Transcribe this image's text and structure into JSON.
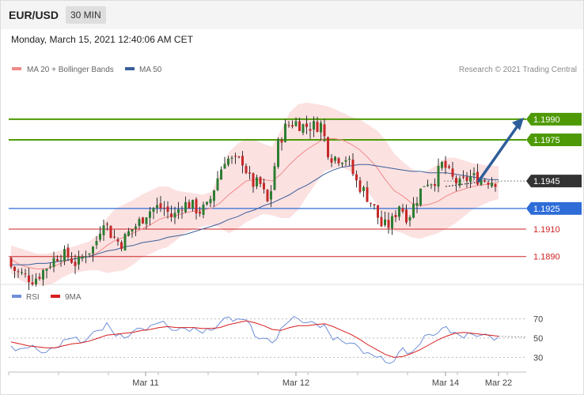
{
  "header": {
    "symbol": "EUR/USD",
    "timeframe": "30 MIN"
  },
  "datetime": "Monday, March 15, 2021 12:40:06 AM CET",
  "legend": {
    "bollinger": {
      "label": "MA 20 + Bollinger Bands",
      "color": "#f08a8a"
    },
    "ma50": {
      "label": "MA 50",
      "color": "#3a5f9a"
    }
  },
  "copyright": "Research © 2021 Trading Central",
  "rsi_legend": {
    "rsi": {
      "label": "RSI",
      "color": "#6f8fd8"
    },
    "ma9": {
      "label": "9MA",
      "color": "#d81e1e"
    }
  },
  "chart_data": [
    {
      "type": "candlestick",
      "y_range": [
        1.1872,
        1.2021
      ],
      "current_price": 1.1945,
      "levels": [
        {
          "value": 1.199,
          "label": "1.1990",
          "kind": "resistance",
          "color": "#4e9a06"
        },
        {
          "value": 1.1975,
          "label": "1.1975",
          "kind": "resistance",
          "color": "#4e9a06"
        },
        {
          "value": 1.1945,
          "label": "1.1945",
          "kind": "current",
          "color": "#333333"
        },
        {
          "value": 1.1925,
          "label": "1.1925",
          "kind": "pivot",
          "color": "#2e6dd8"
        },
        {
          "value": 1.191,
          "label": "1.1910",
          "kind": "support",
          "color": "#cc2222"
        },
        {
          "value": 1.189,
          "label": "1.1890",
          "kind": "support",
          "color": "#cc2222"
        }
      ],
      "target_arrow": {
        "from": 1.1945,
        "to": 1.199
      },
      "x_ticks": [
        "Mar 11",
        "Mar 12",
        "Mar 14",
        "Mar 22"
      ],
      "anchors": [
        1.1885,
        1.1879,
        1.1876,
        1.1873,
        1.1879,
        1.1886,
        1.1892,
        1.189,
        1.1884,
        1.1893,
        1.1897,
        1.1918,
        1.1905,
        1.1899,
        1.1908,
        1.1914,
        1.1922,
        1.1926,
        1.1925,
        1.1918,
        1.1928,
        1.1928,
        1.1923,
        1.1926,
        1.1945,
        1.1962,
        1.1959,
        1.196,
        1.1943,
        1.1943,
        1.1927,
        1.197,
        1.1985,
        1.1988,
        1.1985,
        1.1985,
        1.1986,
        1.1963,
        1.1962,
        1.1962,
        1.1945,
        1.1937,
        1.1927,
        1.1912,
        1.1913,
        1.1928,
        1.1918,
        1.1932,
        1.1945,
        1.1945,
        1.1958,
        1.1947,
        1.1942,
        1.1948,
        1.1947,
        1.1946,
        1.1945
      ],
      "ma20": [
        1.1888,
        1.1884,
        1.1882,
        1.1881,
        1.1881,
        1.1883,
        1.1886,
        1.1888,
        1.1889,
        1.189,
        1.1893,
        1.1898,
        1.1902,
        1.1904,
        1.1907,
        1.191,
        1.1913,
        1.1917,
        1.1919,
        1.192,
        1.1922,
        1.1923,
        1.1924,
        1.1925,
        1.1929,
        1.1935,
        1.194,
        1.1945,
        1.1946,
        1.1946,
        1.1945,
        1.195,
        1.1957,
        1.1963,
        1.1968,
        1.1972,
        1.1976,
        1.1976,
        1.1975,
        1.1972,
        1.1968,
        1.1962,
        1.1955,
        1.1946,
        1.1938,
        1.1934,
        1.1929,
        1.1927,
        1.1928,
        1.193,
        1.1934,
        1.1937,
        1.1939,
        1.1941,
        1.1942,
        1.1943,
        1.1944
      ],
      "bb_upper": [
        1.1898,
        1.1896,
        1.1894,
        1.1892,
        1.1892,
        1.1893,
        1.1895,
        1.1897,
        1.1899,
        1.1901,
        1.1906,
        1.1918,
        1.1925,
        1.1928,
        1.1931,
        1.1935,
        1.1938,
        1.1941,
        1.1941,
        1.1938,
        1.1937,
        1.1936,
        1.1935,
        1.1937,
        1.195,
        1.1966,
        1.1972,
        1.1976,
        1.1975,
        1.1972,
        1.197,
        1.1982,
        1.1995,
        1.2001,
        1.2002,
        1.2001,
        1.2,
        1.1998,
        1.1995,
        1.1992,
        1.199,
        1.1986,
        1.1982,
        1.1975,
        1.1965,
        1.1959,
        1.1954,
        1.1951,
        1.1953,
        1.1957,
        1.1962,
        1.1962,
        1.196,
        1.1958,
        1.1957,
        1.1956,
        1.1956
      ],
      "bb_lower": [
        1.1878,
        1.1873,
        1.187,
        1.1869,
        1.1869,
        1.1871,
        1.1875,
        1.1878,
        1.1879,
        1.188,
        1.188,
        1.1878,
        1.1879,
        1.188,
        1.1884,
        1.1889,
        1.1892,
        1.1895,
        1.1897,
        1.1902,
        1.1907,
        1.191,
        1.1912,
        1.1913,
        1.1911,
        1.1907,
        1.191,
        1.1915,
        1.1918,
        1.1921,
        1.192,
        1.1918,
        1.1918,
        1.1924,
        1.1934,
        1.1943,
        1.1952,
        1.1954,
        1.1955,
        1.1952,
        1.1946,
        1.1937,
        1.1928,
        1.1916,
        1.1909,
        1.1907,
        1.1904,
        1.1903,
        1.1905,
        1.1907,
        1.191,
        1.1914,
        1.1919,
        1.1924,
        1.1927,
        1.193,
        1.1932
      ],
      "ma50": [
        1.1884,
        1.1884,
        1.1884,
        1.1885,
        1.1885,
        1.1886,
        1.1887,
        1.1888,
        1.1889,
        1.189,
        1.1892,
        1.1894,
        1.1895,
        1.1897,
        1.1898,
        1.19,
        1.1901,
        1.1902,
        1.1904,
        1.1905,
        1.1906,
        1.1908,
        1.191,
        1.1912,
        1.1914,
        1.1917,
        1.1919,
        1.1922,
        1.1924,
        1.1927,
        1.1929,
        1.1932,
        1.1935,
        1.1939,
        1.1942,
        1.1946,
        1.195,
        1.1953,
        1.1955,
        1.1956,
        1.1957,
        1.1957,
        1.1956,
        1.1955,
        1.1954,
        1.1953,
        1.1952,
        1.1952,
        1.1951,
        1.1951,
        1.1951,
        1.195,
        1.1949,
        1.1948,
        1.1947,
        1.1946,
        1.1946
      ]
    },
    {
      "type": "line",
      "title": "RSI",
      "y_range": [
        18,
        82
      ],
      "y_ticks": [
        70,
        50,
        30
      ],
      "x_ticks": [
        "Mar 11",
        "Mar 12",
        "Mar 14",
        "Mar 22"
      ],
      "series": [
        {
          "name": "RSI",
          "values": [
            42,
            39,
            40,
            38,
            35,
            40,
            48,
            50,
            45,
            52,
            58,
            66,
            52,
            50,
            57,
            60,
            63,
            66,
            62,
            58,
            60,
            61,
            55,
            58,
            66,
            72,
            70,
            69,
            52,
            50,
            45,
            60,
            68,
            70,
            66,
            65,
            64,
            48,
            47,
            45,
            40,
            35,
            30,
            25,
            26,
            40,
            35,
            44,
            54,
            55,
            62,
            56,
            50,
            54,
            53,
            52,
            51
          ]
        },
        {
          "name": "9MA",
          "values": [
            46,
            44,
            42,
            41,
            40,
            40,
            42,
            44,
            45,
            47,
            50,
            53,
            54,
            55,
            56,
            58,
            59,
            61,
            62,
            61,
            61,
            61,
            60,
            60,
            61,
            64,
            66,
            68,
            66,
            63,
            59,
            58,
            61,
            63,
            63,
            64,
            65,
            62,
            58,
            54,
            49,
            43,
            38,
            33,
            30,
            31,
            34,
            38,
            43,
            48,
            52,
            55,
            56,
            55,
            54,
            53,
            52
          ]
        }
      ]
    }
  ]
}
